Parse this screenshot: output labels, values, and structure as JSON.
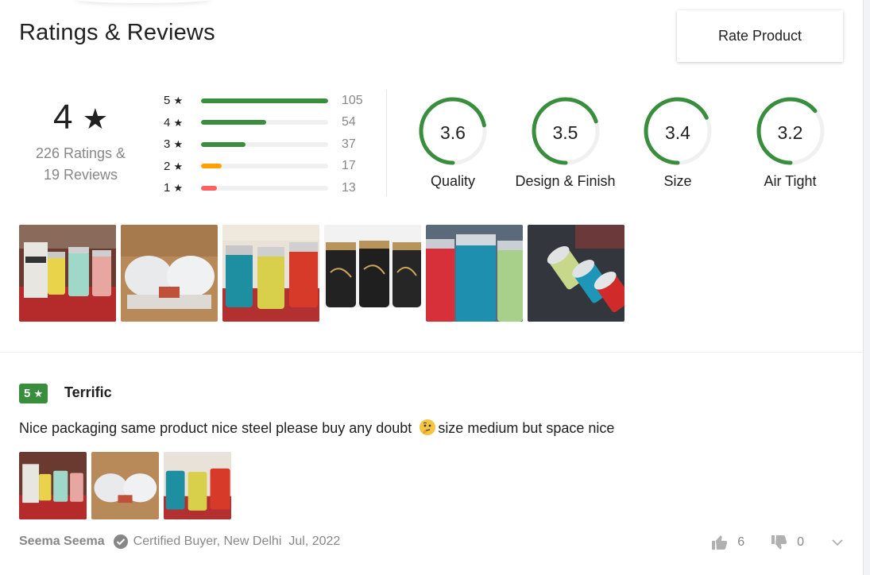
{
  "header": {
    "title": "Ratings & Reviews",
    "rate_button": "Rate Product"
  },
  "overall": {
    "score": "4",
    "star": "★",
    "ratings_text": "226 Ratings &",
    "reviews_text": "19 Reviews"
  },
  "distribution": [
    {
      "label": "5",
      "count": "105",
      "fraction": 1.0,
      "color": "#388e3c"
    },
    {
      "label": "4",
      "count": "54",
      "fraction": 0.514,
      "color": "#388e3c"
    },
    {
      "label": "3",
      "count": "37",
      "fraction": 0.352,
      "color": "#388e3c"
    },
    {
      "label": "2",
      "count": "17",
      "fraction": 0.162,
      "color": "#ff9f00"
    },
    {
      "label": "1",
      "count": "13",
      "fraction": 0.124,
      "color": "#ff6161"
    }
  ],
  "features": [
    {
      "label": "Quality",
      "value": "3.6",
      "fraction": 0.72
    },
    {
      "label": "Design & Finish",
      "value": "3.5",
      "fraction": 0.7
    },
    {
      "label": "Size",
      "value": "3.4",
      "fraction": 0.68
    },
    {
      "label": "Air Tight",
      "value": "3.2",
      "fraction": 0.64
    }
  ],
  "colors": {
    "accent_green": "#388e3c",
    "muted_text": "#878787",
    "track": "#f0f0f0"
  },
  "review": {
    "rating": "5",
    "title": "Terrific",
    "text_before_emoji": "Nice packaging same product nice steel please buy any doubt ",
    "emoji": "thinking-face-emoji",
    "text_after_emoji": "size medium but space nice",
    "author": "Seema Seema",
    "certified": "Certified Buyer, New Delhi",
    "date": "Jul, 2022",
    "likes": "6",
    "dislikes": "0"
  },
  "icons": {
    "star": "star-icon",
    "certified": "check-circle-icon",
    "like": "thumbs-up-icon",
    "dislike": "thumbs-down-icon",
    "expand": "chevron-down-icon"
  }
}
